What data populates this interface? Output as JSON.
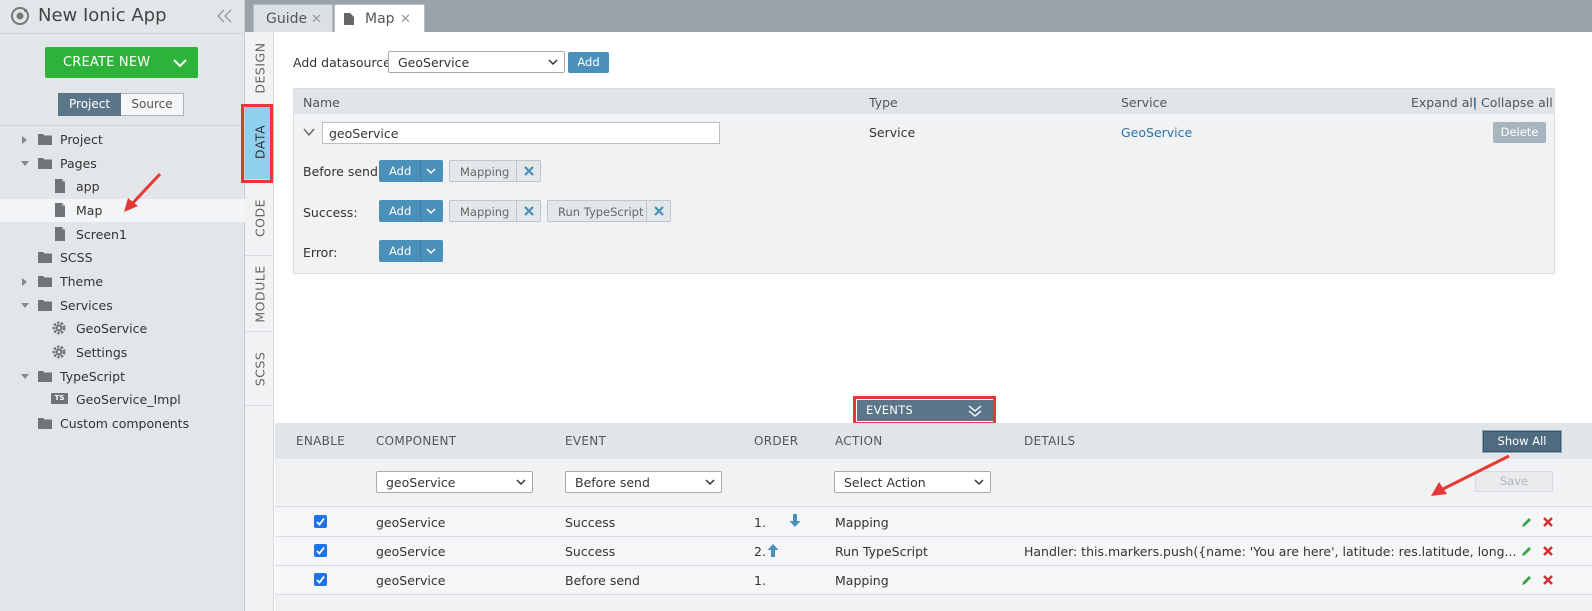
{
  "app": {
    "title": "New Ionic App"
  },
  "sidebar": {
    "create_label": "CREATE NEW",
    "toggle": {
      "project": "Project",
      "source": "Source"
    },
    "tree": [
      {
        "label": "Project",
        "icon": "folder-icon",
        "expander": "collapsed"
      },
      {
        "label": "Pages",
        "icon": "folder-icon",
        "expander": "expanded"
      },
      {
        "label": "app",
        "icon": "page-icon"
      },
      {
        "label": "Map",
        "icon": "page-icon",
        "selected": true
      },
      {
        "label": "Screen1",
        "icon": "page-icon"
      },
      {
        "label": "SCSS",
        "icon": "folder-icon"
      },
      {
        "label": "Theme",
        "icon": "folder-icon",
        "expander": "collapsed"
      },
      {
        "label": "Services",
        "icon": "folder-icon",
        "expander": "expanded"
      },
      {
        "label": "GeoService",
        "icon": "gear-icon"
      },
      {
        "label": "Settings",
        "icon": "gear-icon"
      },
      {
        "label": "TypeScript",
        "icon": "folder-icon",
        "expander": "expanded"
      },
      {
        "label": "GeoService_Impl",
        "icon": "ts-badge",
        "badge": "TS"
      },
      {
        "label": "Custom components",
        "icon": "folder-icon"
      }
    ]
  },
  "tabs": [
    {
      "label": "Guide",
      "active": false
    },
    {
      "label": "Map",
      "active": true
    }
  ],
  "vtabs": [
    "DESIGN",
    "DATA",
    "CODE",
    "MODULE",
    "SCSS"
  ],
  "datasource": {
    "add_label": "Add datasource",
    "select_value": "GeoService",
    "add_button": "Add"
  },
  "ds_table": {
    "headers": {
      "name": "Name",
      "type": "Type",
      "service": "Service"
    },
    "expand_all": "Expand all",
    "divider": "|",
    "collapse_all": "Collapse all",
    "row": {
      "name": "geoService",
      "type": "Service",
      "service": "GeoService",
      "delete": "Delete"
    },
    "before_send": {
      "label": "Before send:",
      "add": "Add",
      "chips": [
        "Mapping"
      ]
    },
    "success": {
      "label": "Success:",
      "add": "Add",
      "chips": [
        "Mapping",
        "Run TypeScript"
      ]
    },
    "error": {
      "label": "Error:",
      "add": "Add"
    }
  },
  "events": {
    "bar_label": "EVENTS",
    "headers": {
      "enable": "ENABLE",
      "component": "COMPONENT",
      "event": "EVENT",
      "order": "ORDER",
      "action": "ACTION",
      "details": "DETAILS"
    },
    "show_all": "Show All",
    "filter": {
      "component": "geoService",
      "event": "Before send",
      "action": "Select Action",
      "save": "Save"
    },
    "rows": [
      {
        "enabled": true,
        "component": "geoService",
        "event": "Success",
        "order": "1.",
        "order_arrow": "down",
        "action": "Mapping",
        "details": ""
      },
      {
        "enabled": true,
        "component": "geoService",
        "event": "Success",
        "order": "2.",
        "order_arrow": "up",
        "action": "Run TypeScript",
        "details": "Handler: this.markers.push({name: 'You are here', latitude: res.latitude, long..."
      },
      {
        "enabled": true,
        "component": "geoService",
        "event": "Before send",
        "order": "1.",
        "order_arrow": "",
        "action": "Mapping",
        "details": ""
      }
    ]
  },
  "colors": {
    "accent_green": "#2eb33a",
    "accent_blue": "#4a90b8",
    "highlight_red": "#e53935",
    "link_blue": "#2a73ad",
    "active_vtab": "#8fd0ef"
  }
}
